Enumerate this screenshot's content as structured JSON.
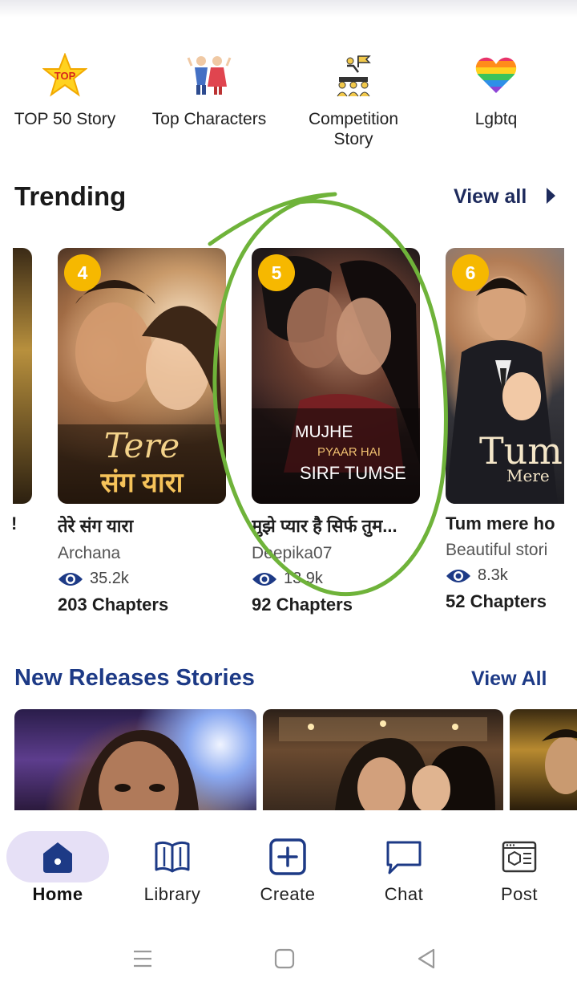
{
  "categories": [
    {
      "label": "TOP 50 Story",
      "icon": "top-star-icon"
    },
    {
      "label": "Top Characters",
      "icon": "characters-icon"
    },
    {
      "label": "Competition Story",
      "icon": "competition-icon"
    },
    {
      "label": "Lgbtq",
      "icon": "rainbow-heart-icon"
    }
  ],
  "trending": {
    "title": "Trending",
    "view_all": "View all",
    "partial_left_title": "!",
    "cards": [
      {
        "rank": "4",
        "title": "तेरे संग यारा",
        "author": "Archana",
        "views": "35.2k",
        "chapters": "203 Chapters",
        "cover_line1": "Tere",
        "cover_line2": "संग यारा"
      },
      {
        "rank": "5",
        "title": "मुझे प्यार है सिर्फ तुम...",
        "author": "Deepika07",
        "views": "13.9k",
        "chapters": "92 Chapters",
        "cover_line1": "MUJHE",
        "cover_line2": "PYAAR HAI",
        "cover_line3": "SIRF TUMSE"
      },
      {
        "rank": "6",
        "title": "Tum mere ho",
        "author": "Beautiful stori",
        "views": "8.3k",
        "chapters": "52 Chapters",
        "cover_line1": "Tum",
        "cover_line2": "Mere"
      }
    ]
  },
  "new_releases": {
    "title": "New Releases Stories",
    "view_all": "View All"
  },
  "nav": {
    "home": "Home",
    "library": "Library",
    "create": "Create",
    "chat": "Chat",
    "post": "Post"
  },
  "colors": {
    "accent": "#1d3a86",
    "rank_badge": "#f6b800",
    "home_pill": "#e6e0f6",
    "annotation": "#6fb33a"
  }
}
